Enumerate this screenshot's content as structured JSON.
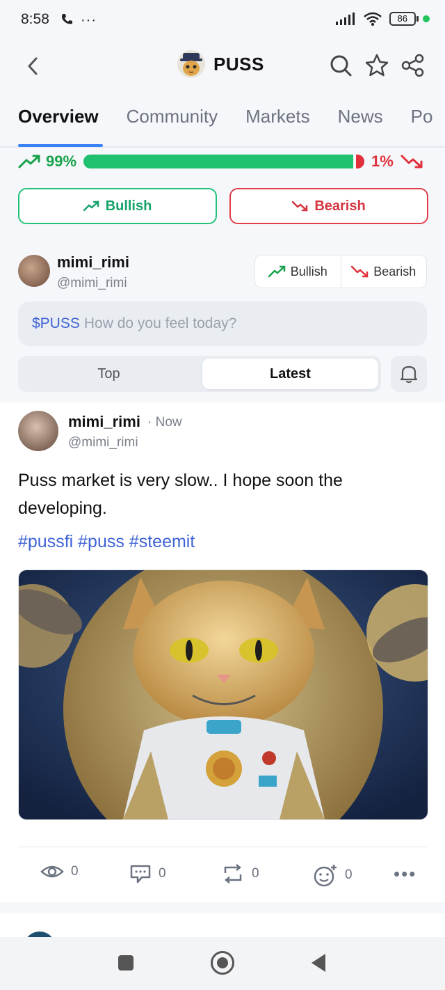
{
  "status": {
    "time": "8:58",
    "battery": "86"
  },
  "header": {
    "title": "PUSS"
  },
  "tabs": [
    {
      "label": "Overview"
    },
    {
      "label": "Community"
    },
    {
      "label": "Markets"
    },
    {
      "label": "News"
    },
    {
      "label": "Po"
    }
  ],
  "sentiment": {
    "bullish_pct": "99%",
    "bearish_pct": "1%",
    "bullish_fraction": 0.99
  },
  "vote": {
    "bullish_label": "Bullish",
    "bearish_label": "Bearish"
  },
  "composer": {
    "name": "mimi_rimi",
    "handle": "@mimi_rimi",
    "bullish_label": "Bullish",
    "bearish_label": "Bearish",
    "ticker": "$PUSS",
    "placeholder": "How do you feel today?"
  },
  "sort": {
    "top_label": "Top",
    "latest_label": "Latest"
  },
  "post": {
    "author": "mimi_rimi",
    "time": "· Now",
    "handle": "@mimi_rimi",
    "text": "Puss market is very slow.. I hope soon the developing.",
    "tags": "#pussfi #puss #steemit",
    "views": "0",
    "comments": "0",
    "reposts": "0",
    "reactions": "0"
  },
  "colors": {
    "accent": "#3b82f6",
    "bull": "#1fc16f",
    "bear": "#e0303c",
    "link": "#3f63d6"
  },
  "icons": [
    "phone-icon",
    "signal-icon",
    "wifi-icon",
    "back-icon",
    "search-icon",
    "star-icon",
    "share-icon",
    "trend-up-icon",
    "trend-down-icon",
    "bell-icon",
    "eye-icon",
    "comment-icon",
    "repost-icon",
    "reaction-icon",
    "more-icon"
  ]
}
